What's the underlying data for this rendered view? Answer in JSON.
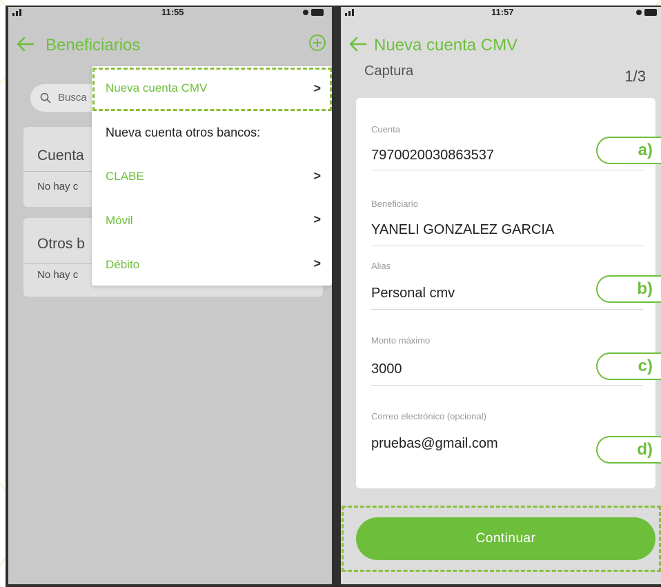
{
  "left_screen": {
    "time": "11:55",
    "title": "Beneficiarios",
    "search_placeholder": "Busca",
    "card1_title": "Cuenta",
    "card1_subtitle": "No hay c",
    "card2_title": "Otros b",
    "card2_subtitle": "No hay c",
    "menu": {
      "item_cmv": "Nueva cuenta CMV",
      "header_other": "Nueva cuenta otros bancos:",
      "item_clabe": "CLABE",
      "item_movil": "Móvil",
      "item_debito": "Débito",
      "chevron": ">"
    }
  },
  "right_screen": {
    "time": "11:57",
    "title": "Nueva cuenta CMV",
    "section": "Captura",
    "step": "1/3",
    "fields": [
      {
        "label": "Cuenta",
        "value": "7970020030863537"
      },
      {
        "label": "Beneficiario",
        "value": "YANELI GONZALEZ GARCIA"
      },
      {
        "label": "Alias",
        "value": "Personal cmv"
      },
      {
        "label": "Monto máximo",
        "value": "3000"
      },
      {
        "label": "Correo electrónico (opcional)",
        "value": "pruebas@gmail.com"
      }
    ],
    "continue_label": "Continuar"
  },
  "callouts": [
    "a)",
    "b)",
    "c)",
    "d)"
  ],
  "colors": {
    "accent": "#6dbf3b",
    "highlight": "#8bbf3a"
  },
  "icons": [
    "back-arrow-icon",
    "add-circle-icon",
    "search-icon",
    "signal-icon",
    "battery-icon",
    "alarm-icon"
  ]
}
